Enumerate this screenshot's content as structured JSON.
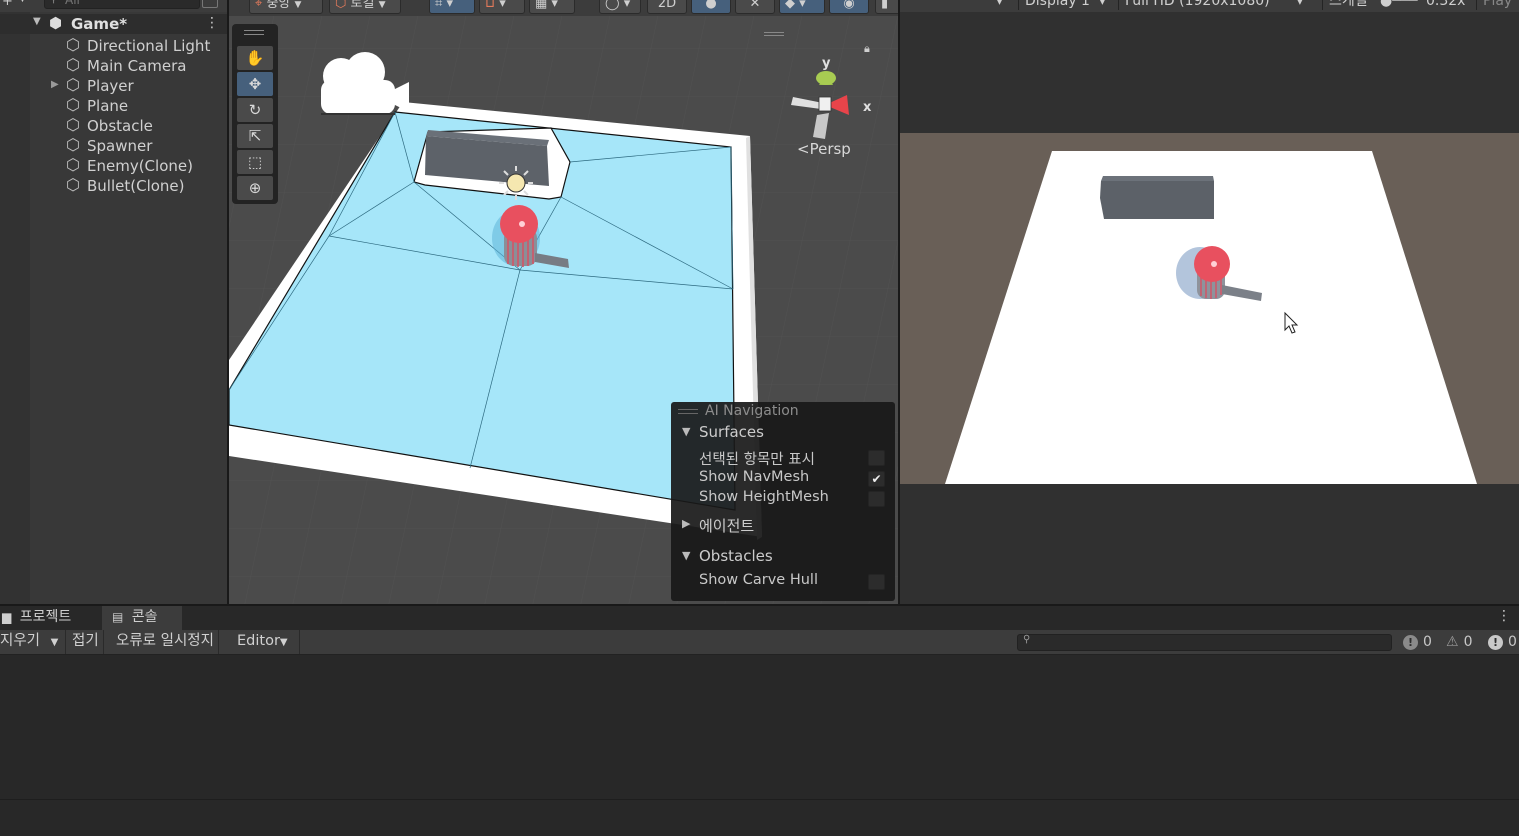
{
  "hierarchy": {
    "search_placeholder": "All",
    "plus_label": "+",
    "scene": {
      "name": "Game*"
    },
    "items": [
      {
        "label": "Directional Light",
        "has_children": false
      },
      {
        "label": "Main Camera",
        "has_children": false
      },
      {
        "label": "Player",
        "has_children": true
      },
      {
        "label": "Plane",
        "has_children": false
      },
      {
        "label": "Obstacle",
        "has_children": false
      },
      {
        "label": "Spawner",
        "has_children": false
      },
      {
        "label": "Enemy(Clone)",
        "has_children": false
      },
      {
        "label": "Bullet(Clone)",
        "has_children": false
      }
    ]
  },
  "scene_toolbar": {
    "pivot_label": "중앙",
    "space_label": "로컬",
    "toggle_2d": "2D"
  },
  "scene_view": {
    "persp_label": "Persp",
    "gizmo_axes": {
      "x": "x",
      "y": "y"
    },
    "tools": [
      "hand-tool",
      "move-tool",
      "rotate-tool",
      "scale-tool",
      "rect-tool",
      "transform-tool"
    ],
    "active_tool": "move-tool"
  },
  "ai_navigation": {
    "title": "AI Navigation",
    "sections": [
      {
        "label": "Surfaces",
        "expanded": true,
        "options": [
          {
            "label": "선택된 항목만 표시",
            "checked": false
          },
          {
            "label": "Show NavMesh",
            "checked": true
          },
          {
            "label": "Show HeightMesh",
            "checked": false
          }
        ]
      },
      {
        "label": "에이전트",
        "expanded": false,
        "options": []
      },
      {
        "label": "Obstacles",
        "expanded": true,
        "options": [
          {
            "label": "Show Carve Hull",
            "checked": false
          }
        ]
      }
    ]
  },
  "game_toolbar": {
    "display_label": "Display 1",
    "resolution_label": "Full HD (1920x1080)",
    "scale_label": "스케일",
    "scale_value": "0.32x",
    "play_label": "Play"
  },
  "bottom_tabs": {
    "project_tab": "프로젝트",
    "console_tab": "콘솔"
  },
  "console": {
    "clear_label": "지우기",
    "collapse_label": "접기",
    "error_pause_label": "오류로 일시정지",
    "editor_label": "Editor",
    "log_count": "0",
    "warning_count": "0",
    "error_count": "0"
  },
  "colors": {
    "navmesh": "#a6e6f9",
    "accent_active": "#46607c",
    "game_background": "#695f57",
    "player_head": "#e8505f"
  }
}
